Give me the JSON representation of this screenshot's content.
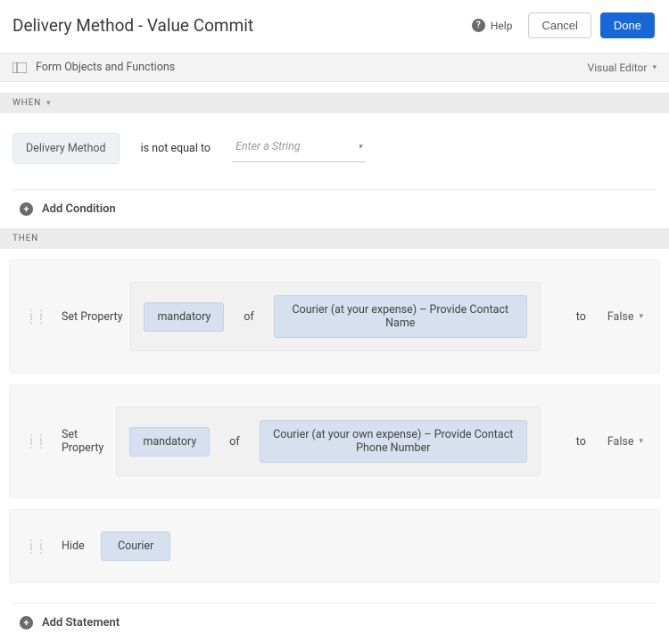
{
  "header": {
    "title": "Delivery Method - Value Commit",
    "help": "Help",
    "cancel": "Cancel",
    "done": "Done"
  },
  "toolbar": {
    "left": "Form Objects and Functions",
    "right": "Visual Editor"
  },
  "sections": {
    "when": "When",
    "then": "Then"
  },
  "when": {
    "subject": "Delivery Method",
    "operator": "is not equal to",
    "placeholder": "Enter a String"
  },
  "add": {
    "condition": "Add Condition",
    "statement": "Add Statement"
  },
  "thenActions": [
    {
      "action": "Set Property",
      "property": "mandatory",
      "of": "of",
      "target": "Courier (at your expense) – Provide Contact Name",
      "to": "to",
      "value": "False"
    },
    {
      "action": "Set Property",
      "property": "mandatory",
      "of": "of",
      "target": "Courier (at your own expense) – Provide Contact Phone Number",
      "to": "to",
      "value": "False"
    },
    {
      "action": "Hide",
      "target": "Courier"
    }
  ]
}
